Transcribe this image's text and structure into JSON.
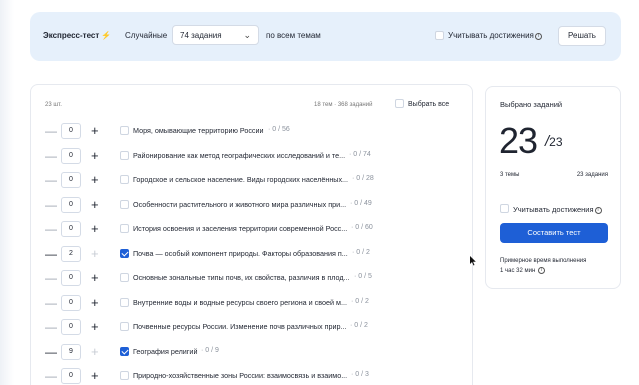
{
  "express": {
    "title": "Экспресс-тест",
    "lightning": "⚡",
    "mode": "Случайные",
    "task_select": "74 задания",
    "topics_scope": "по всем темам",
    "achievements_label": "Учитывать достижения",
    "info_glyph": "i",
    "solve_button": "Решать"
  },
  "topics": {
    "count_label": "23 шт.",
    "summary_label": "18 тем · 368 заданий",
    "select_all_label": "Выбрать все",
    "rows": [
      {
        "qty": "0",
        "name": "Моря, омывающие территорию России",
        "score": "· 0 / 56",
        "checked": false
      },
      {
        "qty": "0",
        "name": "Районирование как метод географических исследований и те...",
        "score": "· 0 / 74",
        "checked": false
      },
      {
        "qty": "0",
        "name": "Городское и сельское население. Виды городских населённых...",
        "score": "· 0 / 28",
        "checked": false
      },
      {
        "qty": "0",
        "name": "Особенности растительного и животного мира различных при...",
        "score": "· 0 / 49",
        "checked": false
      },
      {
        "qty": "0",
        "name": "История освоения и заселения территории современной Росс...",
        "score": "· 0 / 60",
        "checked": false
      },
      {
        "qty": "2",
        "name": "Почва — особый компонент природы. Факторы образования п...",
        "score": "· 0 / 2",
        "checked": true
      },
      {
        "qty": "0",
        "name": "Основные зональные типы почв, их свойства, различия в плод...",
        "score": "· 0 / 5",
        "checked": false
      },
      {
        "qty": "0",
        "name": "Внутренние воды и водные ресурсы своего региона и своей м...",
        "score": "· 0 / 2",
        "checked": false
      },
      {
        "qty": "0",
        "name": "Почвенные ресурсы России. Изменение почв различных прир...",
        "score": "· 0 / 2",
        "checked": false
      },
      {
        "qty": "9",
        "name": "География религий",
        "score": "· 0 / 9",
        "checked": true
      },
      {
        "qty": "0",
        "name": "Природно-хозяйственные зоны России: взаимосвязь и взаимо...",
        "score": "· 0 / 3",
        "checked": false
      }
    ]
  },
  "selected": {
    "title": "Выбрано заданий",
    "count": "23",
    "total": "23",
    "themes_label": "3 темы",
    "tasks_label": "23 задания",
    "achievements_label": "Учитывать достижения",
    "compose_button": "Составить тест",
    "eta_label": "Примерное время выполнения",
    "eta_value": "1 час 32 мин"
  },
  "colors": {
    "accent": "#1e5fd6",
    "express_bg": "#e6f0fb"
  }
}
